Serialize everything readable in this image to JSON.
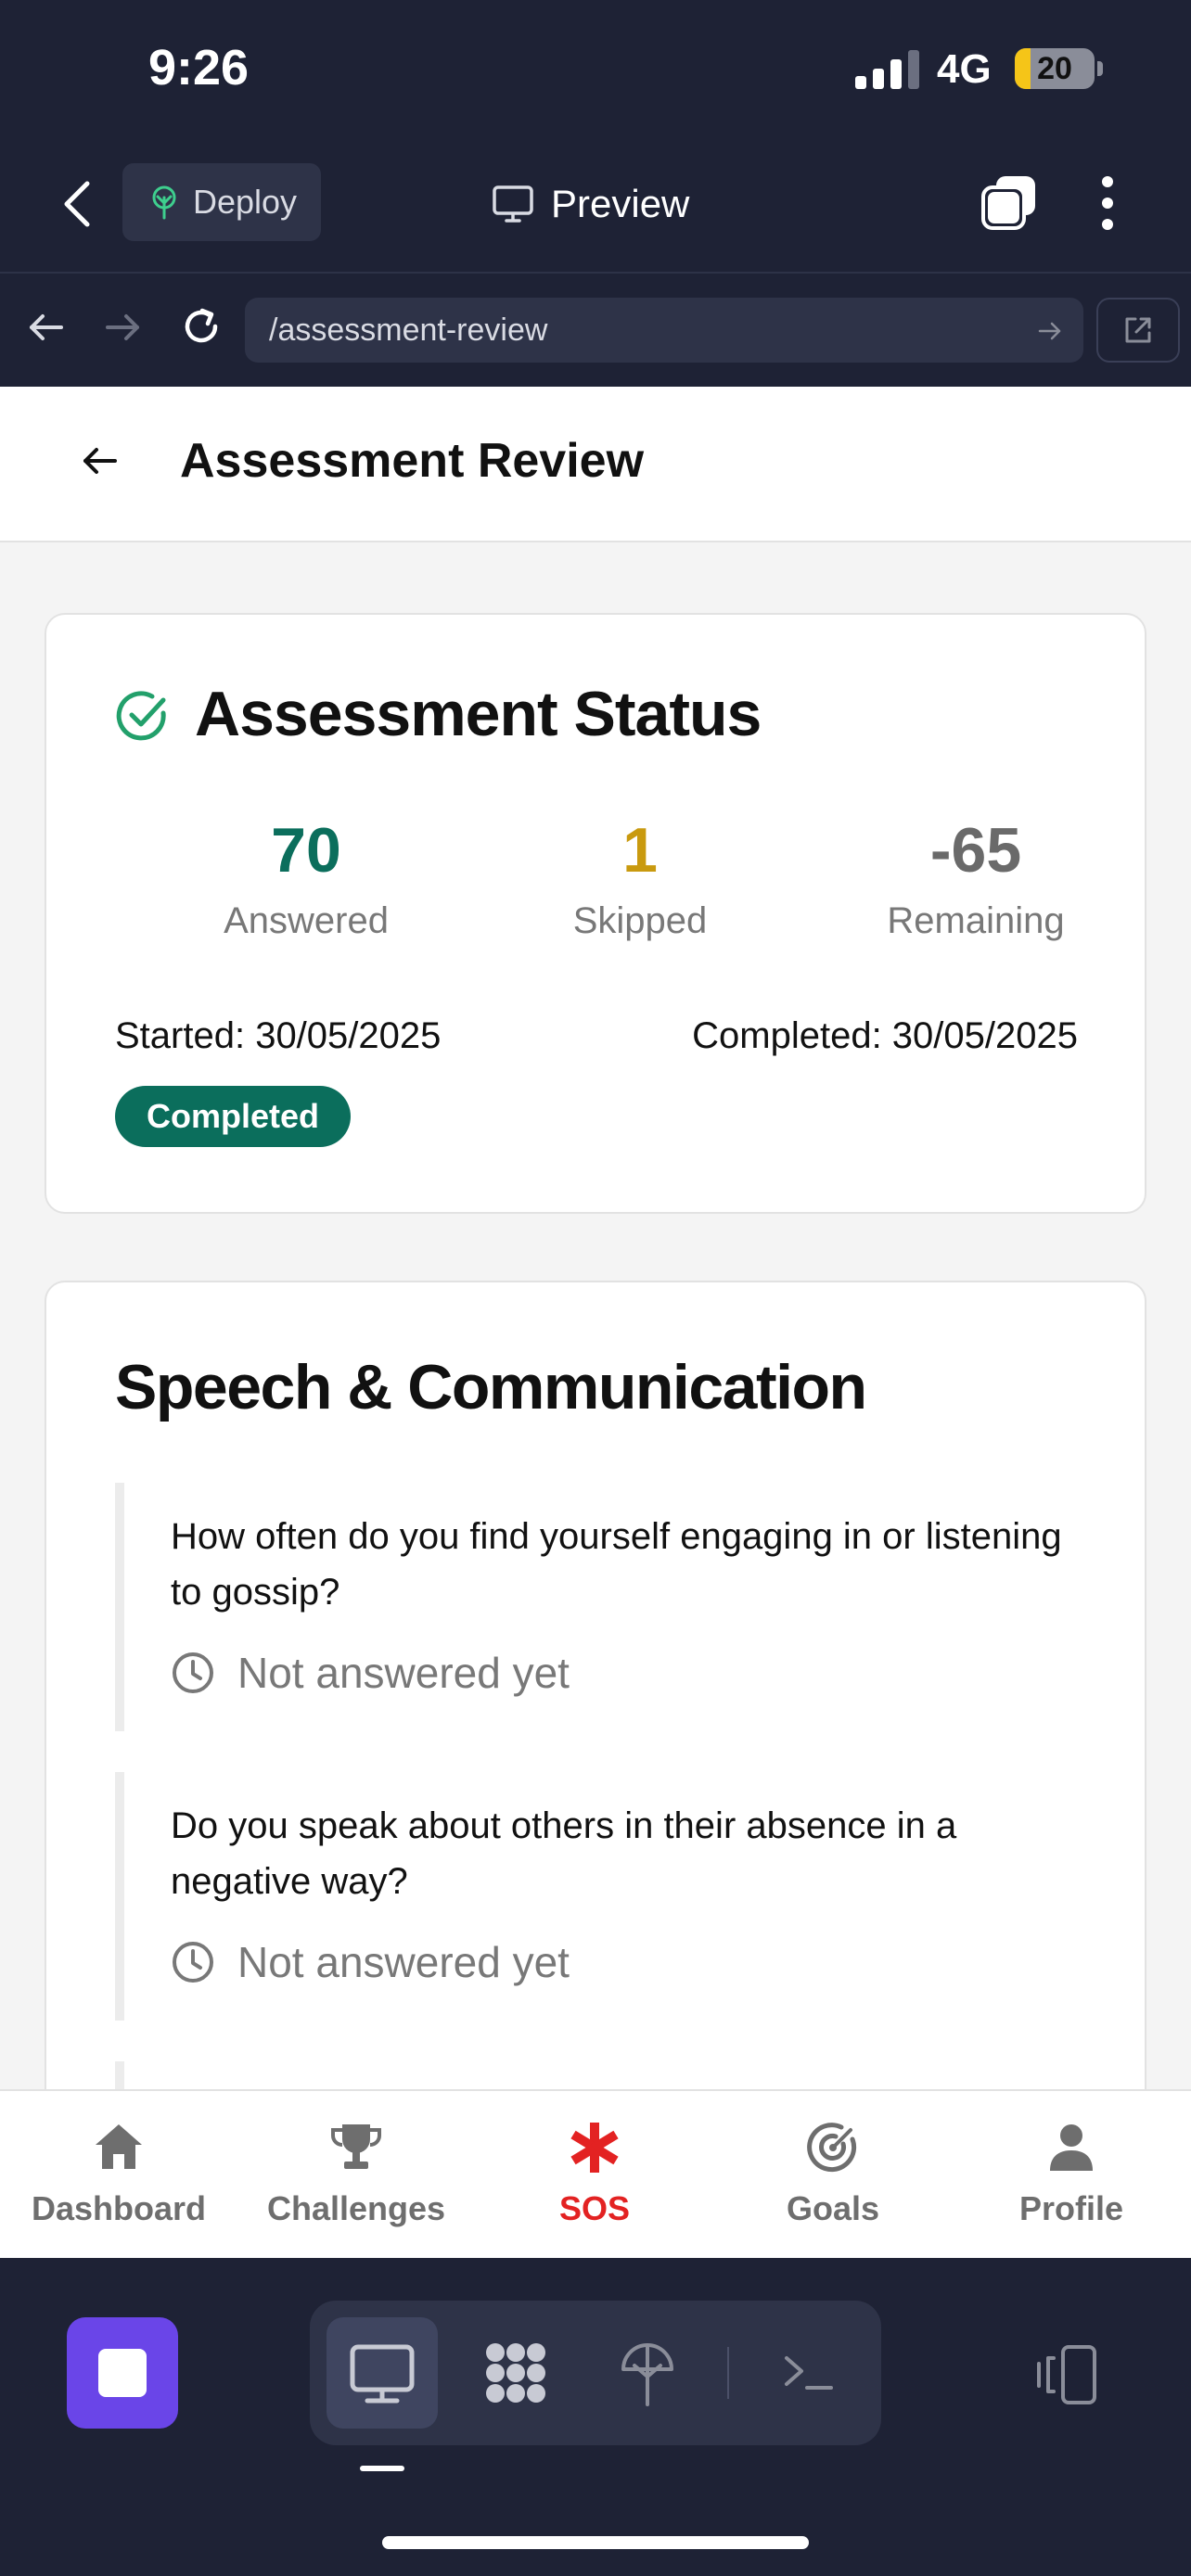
{
  "status_bar": {
    "time": "9:26",
    "network": "4G",
    "battery": "20",
    "battery_level": 0.2,
    "signal_bars_active": 3,
    "battery_color": "#f5c518"
  },
  "app_bar": {
    "deploy_label": "Deploy",
    "preview_label": "Preview"
  },
  "browser": {
    "url": "/assessment-review"
  },
  "page": {
    "title": "Assessment Review"
  },
  "status_card": {
    "title": "Assessment Status",
    "stats": [
      {
        "value": "70",
        "label": "Answered",
        "color": "#0b6e5c"
      },
      {
        "value": "1",
        "label": "Skipped",
        "color": "#c99a0f"
      },
      {
        "value": "-65",
        "label": "Remaining",
        "color": "#6a6a6a"
      }
    ],
    "started": "Started: 30/05/2025",
    "completed": "Completed: 30/05/2025",
    "badge": "Completed",
    "accent_color": "#0b6e5c"
  },
  "section": {
    "title": "Speech & Communication",
    "questions": [
      {
        "text": "How often do you find yourself engaging in or listening to gossip?",
        "status": "Not answered yet"
      },
      {
        "text": "Do you speak about others in their absence in a negative way?",
        "status": "Not answered yet"
      }
    ]
  },
  "tabs": [
    {
      "label": "Dashboard",
      "icon": "home-icon"
    },
    {
      "label": "Challenges",
      "icon": "trophy-icon"
    },
    {
      "label": "SOS",
      "icon": "asterisk-icon",
      "color": "#e32222"
    },
    {
      "label": "Goals",
      "icon": "target-icon"
    },
    {
      "label": "Profile",
      "icon": "person-icon"
    }
  ],
  "dock": {
    "items": [
      "monitor-icon",
      "grid-icon",
      "antenna-icon",
      "terminal-icon"
    ],
    "stop_color": "#6a45e8"
  }
}
